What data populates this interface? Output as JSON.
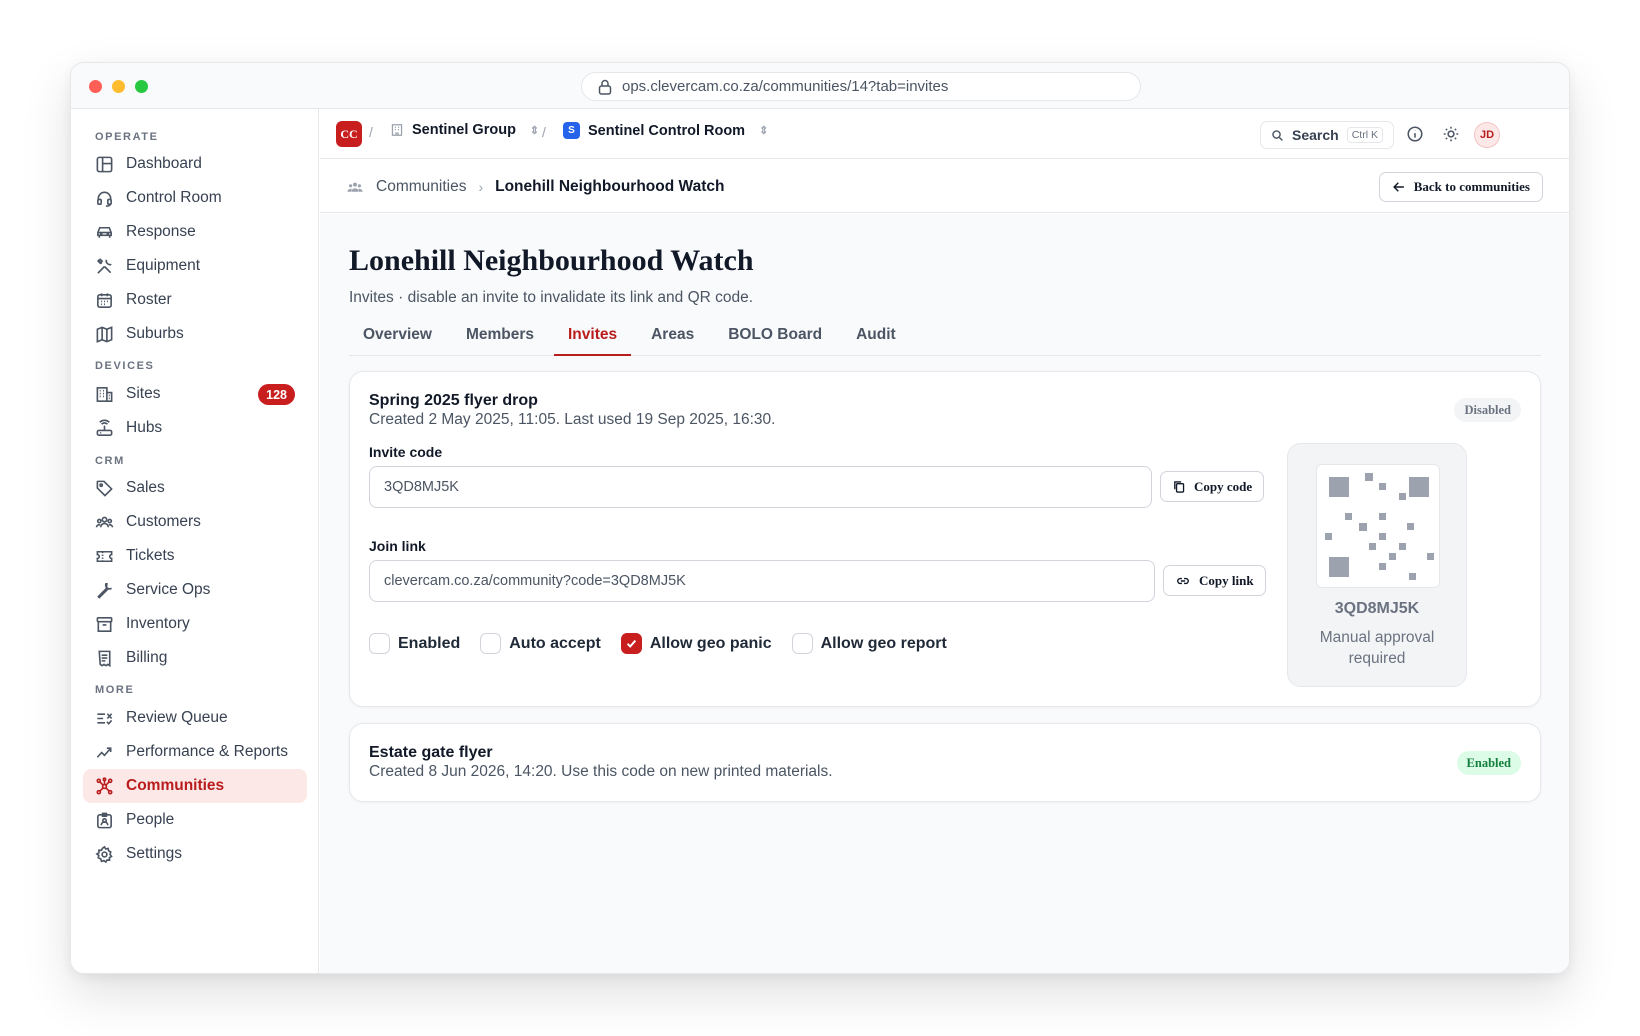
{
  "browser": {
    "url": "ops.clevercam.co.za/communities/14?tab=invites"
  },
  "sidebar": {
    "sections": {
      "operate": "OPERATE",
      "devices": "DEVICES",
      "crm": "CRM",
      "more": "MORE"
    },
    "items": {
      "dashboard": "Dashboard",
      "control_room": "Control Room",
      "response": "Response",
      "equipment": "Equipment",
      "roster": "Roster",
      "suburbs": "Suburbs",
      "sites": "Sites",
      "sites_count": "128",
      "hubs": "Hubs",
      "sales": "Sales",
      "customers": "Customers",
      "tickets": "Tickets",
      "service_ops": "Service Ops",
      "inventory": "Inventory",
      "billing": "Billing",
      "review_queue": "Review Queue",
      "performance": "Performance & Reports",
      "communities": "Communities",
      "people": "People",
      "settings": "Settings"
    }
  },
  "header": {
    "org_logo": "CC",
    "separator": "/",
    "org": "Sentinel Group",
    "workspace_badge": "S",
    "workspace": "Sentinel Control Room",
    "search_label": "Search",
    "search_shortcut": "Ctrl K",
    "avatar": "JD"
  },
  "subheader": {
    "breadcrumb_parent": "Communities",
    "breadcrumb_current": "Lonehill Neighbourhood Watch",
    "back_label": "Back to communities"
  },
  "page": {
    "title": "Lonehill Neighbourhood Watch",
    "subtitle": "Invites · disable an invite to invalidate its link and QR code.",
    "tabs": [
      "Overview",
      "Members",
      "Invites",
      "Areas",
      "BOLO Board",
      "Audit"
    ]
  },
  "invites": [
    {
      "name": "Spring 2025 flyer drop",
      "meta": "Created 2 May 2025, 11:05. Last used 19 Sep 2025, 16:30.",
      "status": "Disabled",
      "code_label": "Invite code",
      "code": "3QD8MJ5K",
      "copy_code_label": "Copy code",
      "link_label": "Join link",
      "link": "clevercam.co.za/community?code=3QD8MJ5K",
      "copy_link_label": "Copy link",
      "options": {
        "enabled": {
          "label": "Enabled",
          "checked": false
        },
        "auto_accept": {
          "label": "Auto accept",
          "checked": false
        },
        "allow_geo_panic": {
          "label": "Allow geo panic",
          "checked": true
        },
        "allow_geo_report": {
          "label": "Allow geo report",
          "checked": false
        }
      },
      "qr_code_text": "3QD8MJ5K",
      "qr_note": "Manual approval required"
    },
    {
      "name": "Estate gate flyer",
      "meta": "Created 8 Jun 2026, 14:20. Use this code on new printed materials.",
      "status": "Enabled"
    }
  ],
  "colors": {
    "accent": "#c81e1e",
    "active_nav_bg": "#fde8e8",
    "enabled_pill_bg": "#dcfce7",
    "enabled_pill_text": "#15803d",
    "disabled_pill_bg": "#f3f4f6",
    "workspace_badge": "#2563eb"
  }
}
